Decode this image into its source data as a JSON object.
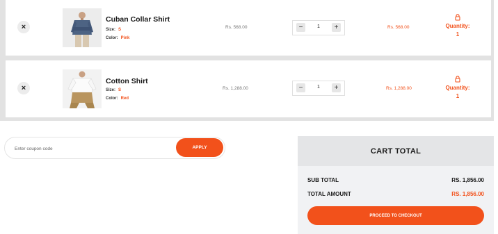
{
  "cart": {
    "items": [
      {
        "name": "Cuban Collar Shirt",
        "size_label": "Size:",
        "size": "S",
        "color_label": "Color:",
        "color": "Pink",
        "price": "Rs. 568.00",
        "quantity": "1",
        "subtotal": "Rs. 568.00",
        "qty_label": "Quantity:",
        "qty_value": "1",
        "image": "shirt-photo-denim-blue"
      },
      {
        "name": "Cotton Shirt",
        "size_label": "Size:",
        "size": "S",
        "color_label": "Color:",
        "color": "Red",
        "price": "Rs. 1,288.00",
        "quantity": "1",
        "subtotal": "Rs. 1,288.00",
        "qty_label": "Quantity:",
        "qty_value": "1",
        "image": "shirt-photo-white"
      }
    ],
    "remove_icon": "×",
    "minus": "−",
    "plus": "+"
  },
  "coupon": {
    "placeholder": "Enter coupon code",
    "value": "",
    "apply_label": "APPLY"
  },
  "totals": {
    "title": "CART TOTAL",
    "sub_total_label": "SUB TOTAL",
    "sub_total_value": "RS. 1,856.00",
    "total_amount_label": "TOTAL AMOUNT",
    "total_amount_value": "RS. 1,856.00",
    "checkout_label": "PROCEED TO CHECKOUT"
  },
  "colors": {
    "accent": "#f2511b",
    "panel_bg": "#f1f2f4",
    "frame_bg": "#e2e2e2"
  },
  "icons": {
    "remove": "close-icon",
    "lock": "lock-icon"
  }
}
